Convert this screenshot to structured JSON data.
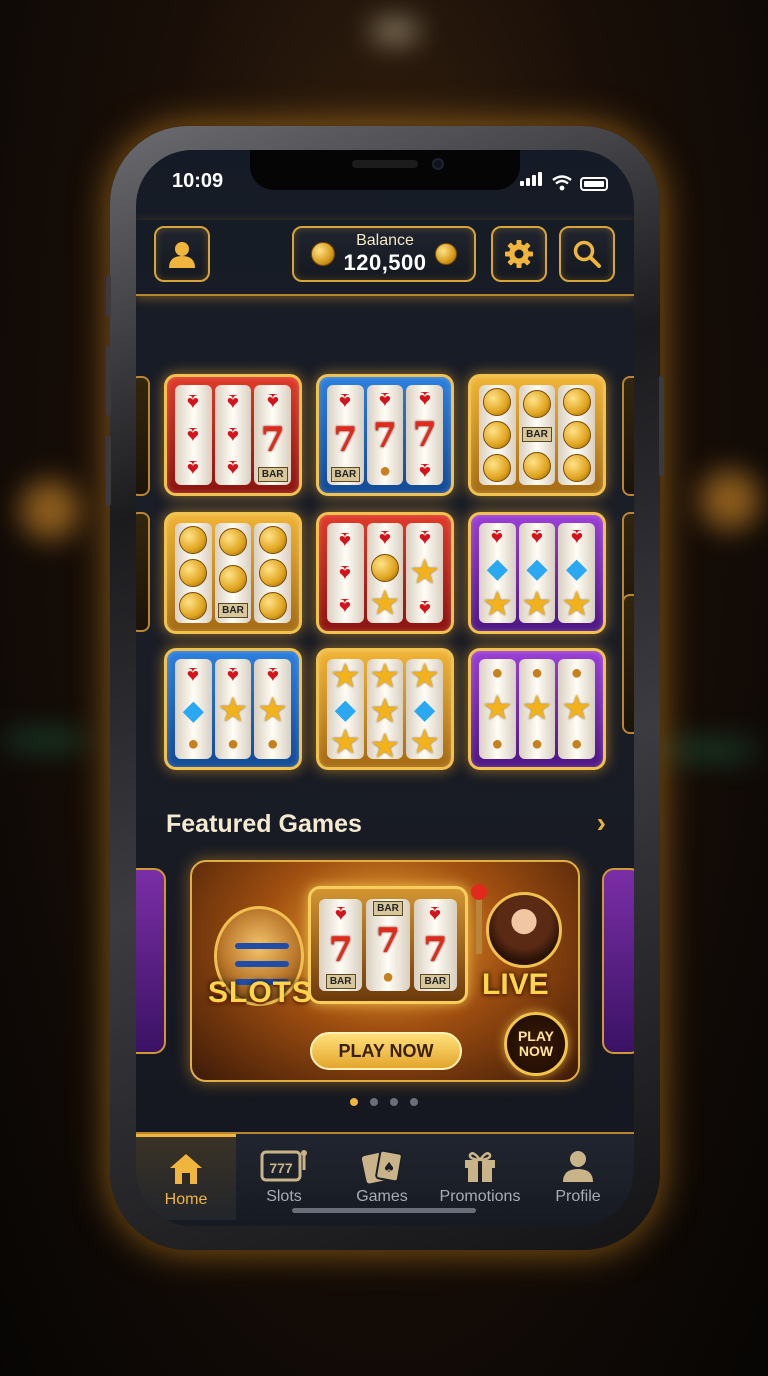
{
  "status_bar": {
    "time": "10:09"
  },
  "header": {
    "balance_label": "Balance",
    "balance_value": "120,500"
  },
  "slot_tiles": [
    {
      "theme": "red",
      "reels": [
        [
          "cherry",
          "cherry",
          "cherry"
        ],
        [
          "cherry",
          "cherry",
          "cherry"
        ],
        [
          "cherry",
          "seven",
          "BAR"
        ]
      ]
    },
    {
      "theme": "blue",
      "reels": [
        [
          "cherry",
          "seven",
          "BAR"
        ],
        [
          "cherry",
          "seven",
          "fruit"
        ],
        [
          "cherry",
          "seven",
          "cherry"
        ]
      ]
    },
    {
      "theme": "gold",
      "reels": [
        [
          "coin",
          "coin",
          "coin"
        ],
        [
          "coin",
          "BAR",
          "coin"
        ],
        [
          "coin",
          "coin",
          "coin"
        ]
      ]
    },
    {
      "theme": "gold",
      "reels": [
        [
          "coin",
          "coin",
          "coin"
        ],
        [
          "coin",
          "coin",
          "BAR"
        ],
        [
          "coin",
          "coin",
          "coin"
        ]
      ]
    },
    {
      "theme": "red",
      "reels": [
        [
          "cherry",
          "cherry",
          "cherry"
        ],
        [
          "cherry",
          "coin",
          "star"
        ],
        [
          "cherry",
          "star",
          "cherry"
        ]
      ]
    },
    {
      "theme": "purple",
      "reels": [
        [
          "cherry",
          "gem",
          "star"
        ],
        [
          "cherry",
          "gem",
          "star"
        ],
        [
          "cherry",
          "gem",
          "star"
        ]
      ]
    },
    {
      "theme": "blue",
      "reels": [
        [
          "cherry",
          "gem",
          "fruit"
        ],
        [
          "cherry",
          "star",
          "fruit"
        ],
        [
          "cherry",
          "star",
          "fruit"
        ]
      ]
    },
    {
      "theme": "gold",
      "reels": [
        [
          "star",
          "gem",
          "star"
        ],
        [
          "star",
          "star",
          "star"
        ],
        [
          "star",
          "gem",
          "star"
        ]
      ]
    },
    {
      "theme": "purple",
      "reels": [
        [
          "fruit",
          "star",
          "fruit"
        ],
        [
          "fruit",
          "star",
          "fruit"
        ],
        [
          "fruit",
          "star",
          "fruit"
        ]
      ]
    }
  ],
  "featured": {
    "title": "Featured Games",
    "banner": {
      "slots_label": "SLOTS",
      "live_label": "LIVE",
      "play_button": "PLAY NOW",
      "badge": "PLAY NOW",
      "machine_reels": [
        [
          "cherry",
          "seven",
          "BAR"
        ],
        [
          "BAR",
          "seven",
          "fruit"
        ],
        [
          "cherry",
          "seven",
          "BAR"
        ]
      ]
    },
    "carousel_pages": 4,
    "carousel_active": 0
  },
  "tabs": [
    {
      "label": "Home",
      "icon": "home-icon",
      "active": true
    },
    {
      "label": "Slots",
      "icon": "slot-machine-icon",
      "active": false
    },
    {
      "label": "Games",
      "icon": "cards-icon",
      "active": false
    },
    {
      "label": "Promotions",
      "icon": "gift-icon",
      "active": false
    },
    {
      "label": "Profile",
      "icon": "profile-icon",
      "active": false
    }
  ],
  "colors": {
    "accent_gold": "#f0b53c",
    "screen_bg": "#151b26",
    "tile_red": "#e03a2a",
    "tile_blue": "#2b7fe0",
    "tile_gold": "#f0b334",
    "tile_purple": "#9a3ed8"
  }
}
